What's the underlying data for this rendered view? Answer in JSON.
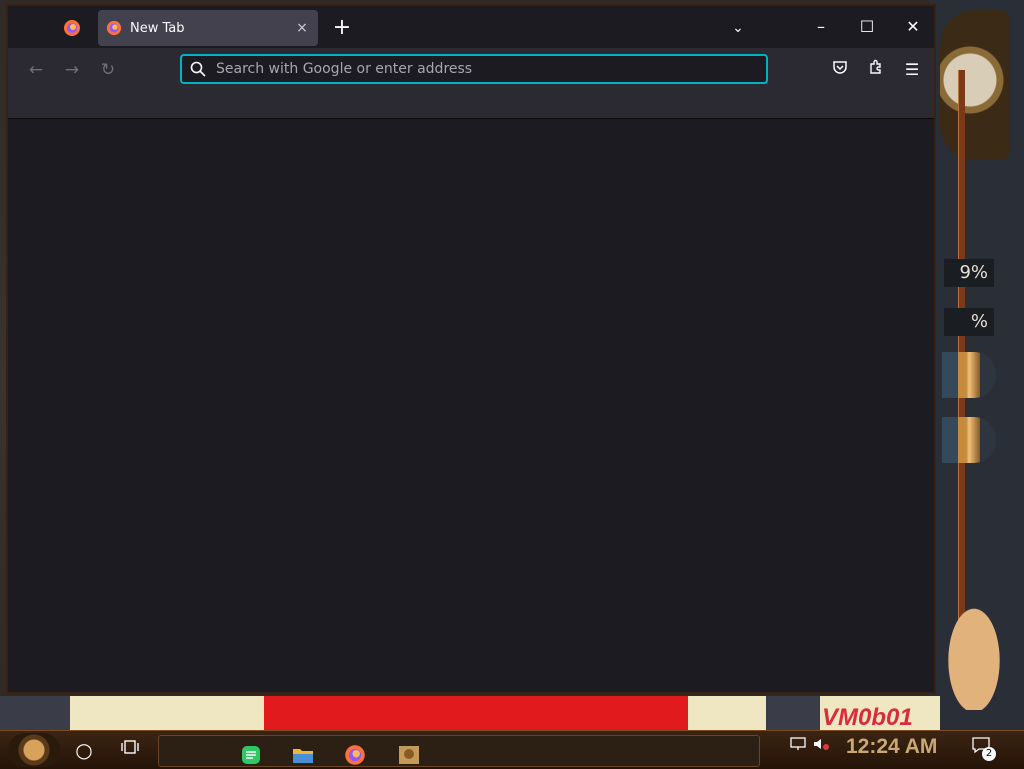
{
  "browser": {
    "tab": {
      "title": "New Tab",
      "close_glyph": "×"
    },
    "new_tab_glyph": "+",
    "list_tabs_glyph": "⌄",
    "window_controls": {
      "minimize": "–",
      "maximize": "☐",
      "close": "✕"
    },
    "nav": {
      "back": "←",
      "forward": "→",
      "reload": "↻"
    },
    "urlbar": {
      "placeholder": "Search with Google or enter address",
      "value": ""
    },
    "toolbar": {
      "pocket": "pocket-icon",
      "extensions": "extensions-icon",
      "menu": "☰"
    },
    "accent": "#00b3c4"
  },
  "desktop": {
    "gauges": [
      "9%",
      "%"
    ],
    "watermark": "VM0b01"
  },
  "taskbar": {
    "time": "12:24 AM",
    "notification_count": "2",
    "apps": [
      "notes-app-icon",
      "file-explorer-icon",
      "firefox-icon",
      "toolbox-icon"
    ]
  }
}
